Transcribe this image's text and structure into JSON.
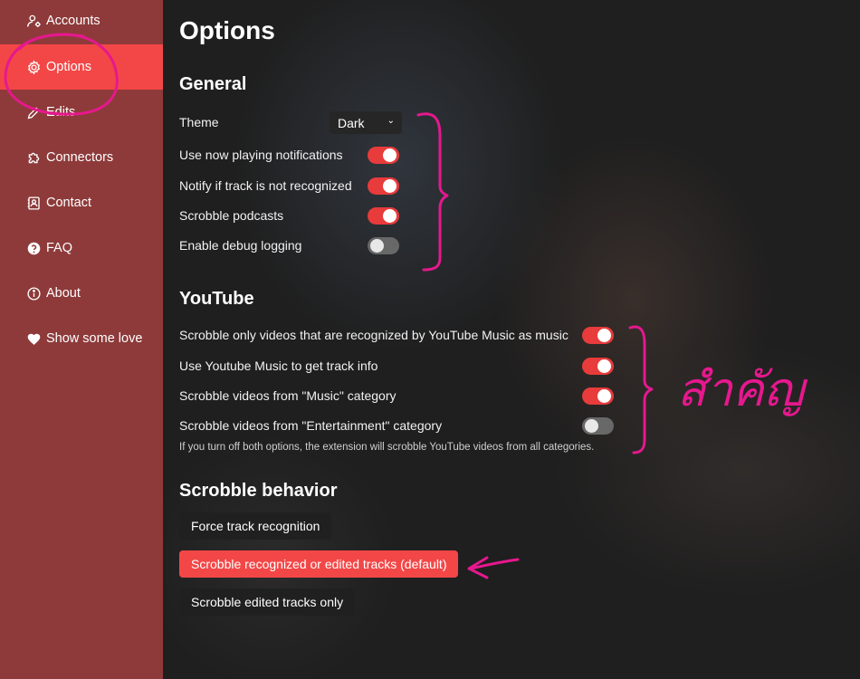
{
  "sidebar": {
    "items": [
      {
        "label": "Accounts"
      },
      {
        "label": "Options"
      },
      {
        "label": "Edits"
      },
      {
        "label": "Connectors"
      },
      {
        "label": "Contact"
      },
      {
        "label": "FAQ"
      },
      {
        "label": "About"
      },
      {
        "label": "Show some love"
      }
    ],
    "active": "Options"
  },
  "page": {
    "title": "Options"
  },
  "general": {
    "title": "General",
    "theme_label": "Theme",
    "theme_value": "Dark",
    "now_playing_label": "Use now playing notifications",
    "now_playing_on": true,
    "notify_unrecognized_label": "Notify if track is not recognized",
    "notify_unrecognized_on": true,
    "scrobble_podcasts_label": "Scrobble podcasts",
    "scrobble_podcasts_on": true,
    "debug_logging_label": "Enable debug logging",
    "debug_logging_on": false
  },
  "youtube": {
    "title": "YouTube",
    "only_music_label": "Scrobble only videos that are recognized by YouTube Music as music",
    "only_music_on": true,
    "use_ytm_label": "Use Youtube Music to get track info",
    "use_ytm_on": true,
    "music_category_label": "Scrobble videos from \"Music\" category",
    "music_category_on": true,
    "entertainment_category_label": "Scrobble videos from \"Entertainment\" category",
    "entertainment_category_on": false,
    "hint": "If you turn off both options, the extension will scrobble YouTube videos from all categories."
  },
  "scrobble_behavior": {
    "title": "Scrobble behavior",
    "options": [
      {
        "label": "Force track recognition",
        "selected": false
      },
      {
        "label": "Scrobble recognized or edited tracks (default)",
        "selected": true
      },
      {
        "label": "Scrobble edited tracks only",
        "selected": false
      }
    ]
  },
  "annotations": {
    "handwriting": "สำคัญ"
  },
  "colors": {
    "sidebar": "#8e3a3a",
    "accent": "#f34747",
    "annotation": "#e6188e"
  }
}
